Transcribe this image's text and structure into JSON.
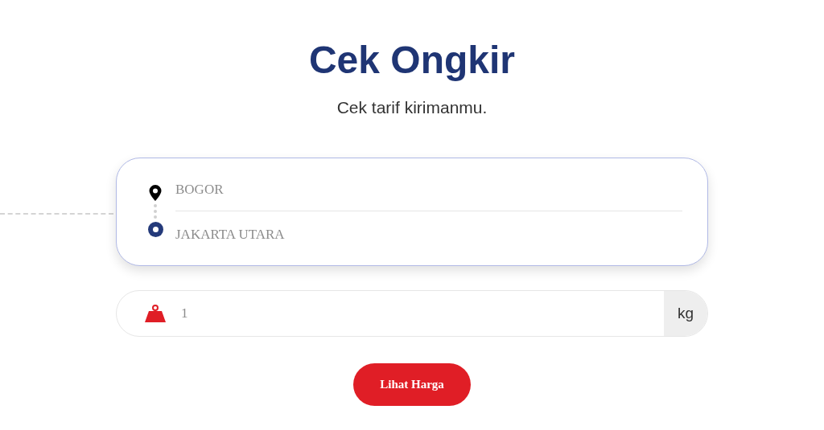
{
  "title": "Cek Ongkir",
  "subtitle": "Cek tarif kirimanmu.",
  "route": {
    "origin": {
      "value": "BOGOR"
    },
    "destination": {
      "value": "JAKARTA UTARA"
    }
  },
  "weight": {
    "value": "1",
    "unit": "kg"
  },
  "button": {
    "label": "Lihat Harga"
  }
}
